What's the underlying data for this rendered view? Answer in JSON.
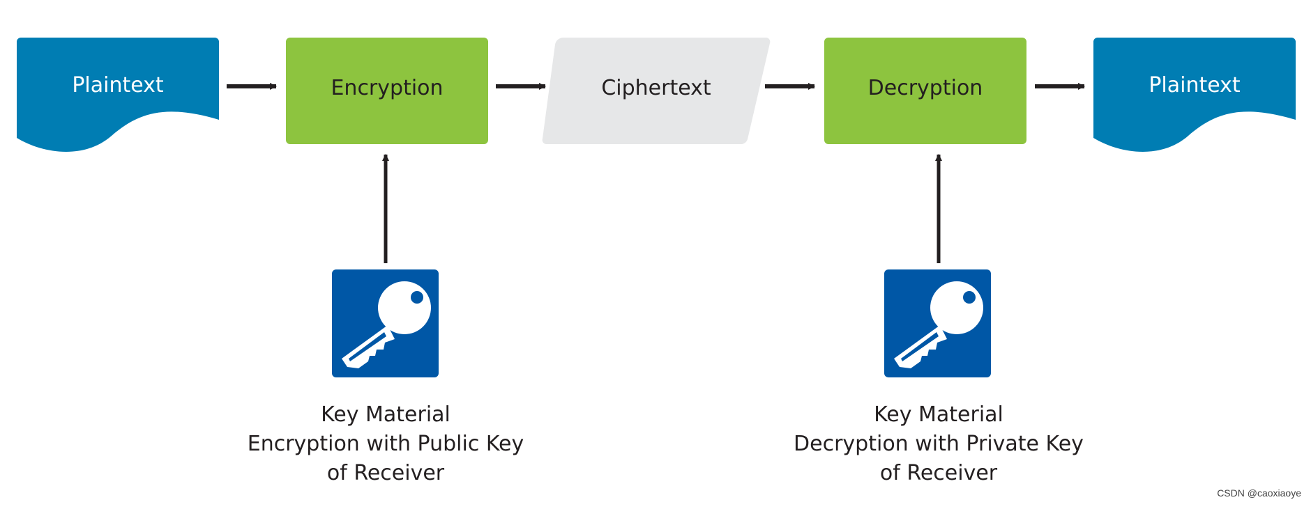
{
  "colors": {
    "plaintext": "#007db3",
    "process": "#8dc43f",
    "ciphertext": "#e6e7e8",
    "key_bg": "#0057a6",
    "arrow": "#231f20"
  },
  "flow": {
    "plaintext_in": "Plaintext",
    "encryption": "Encryption",
    "ciphertext": "Ciphertext",
    "decryption": "Decryption",
    "plaintext_out": "Plaintext"
  },
  "keys": {
    "left": {
      "icon": "key-icon",
      "line1": "Key Material",
      "line2": "Encryption with Public Key",
      "line3": "of Receiver"
    },
    "right": {
      "icon": "key-icon",
      "line1": "Key Material",
      "line2": "Decryption with Private Key",
      "line3": "of Receiver"
    }
  },
  "watermark": "CSDN @caoxiaoye"
}
